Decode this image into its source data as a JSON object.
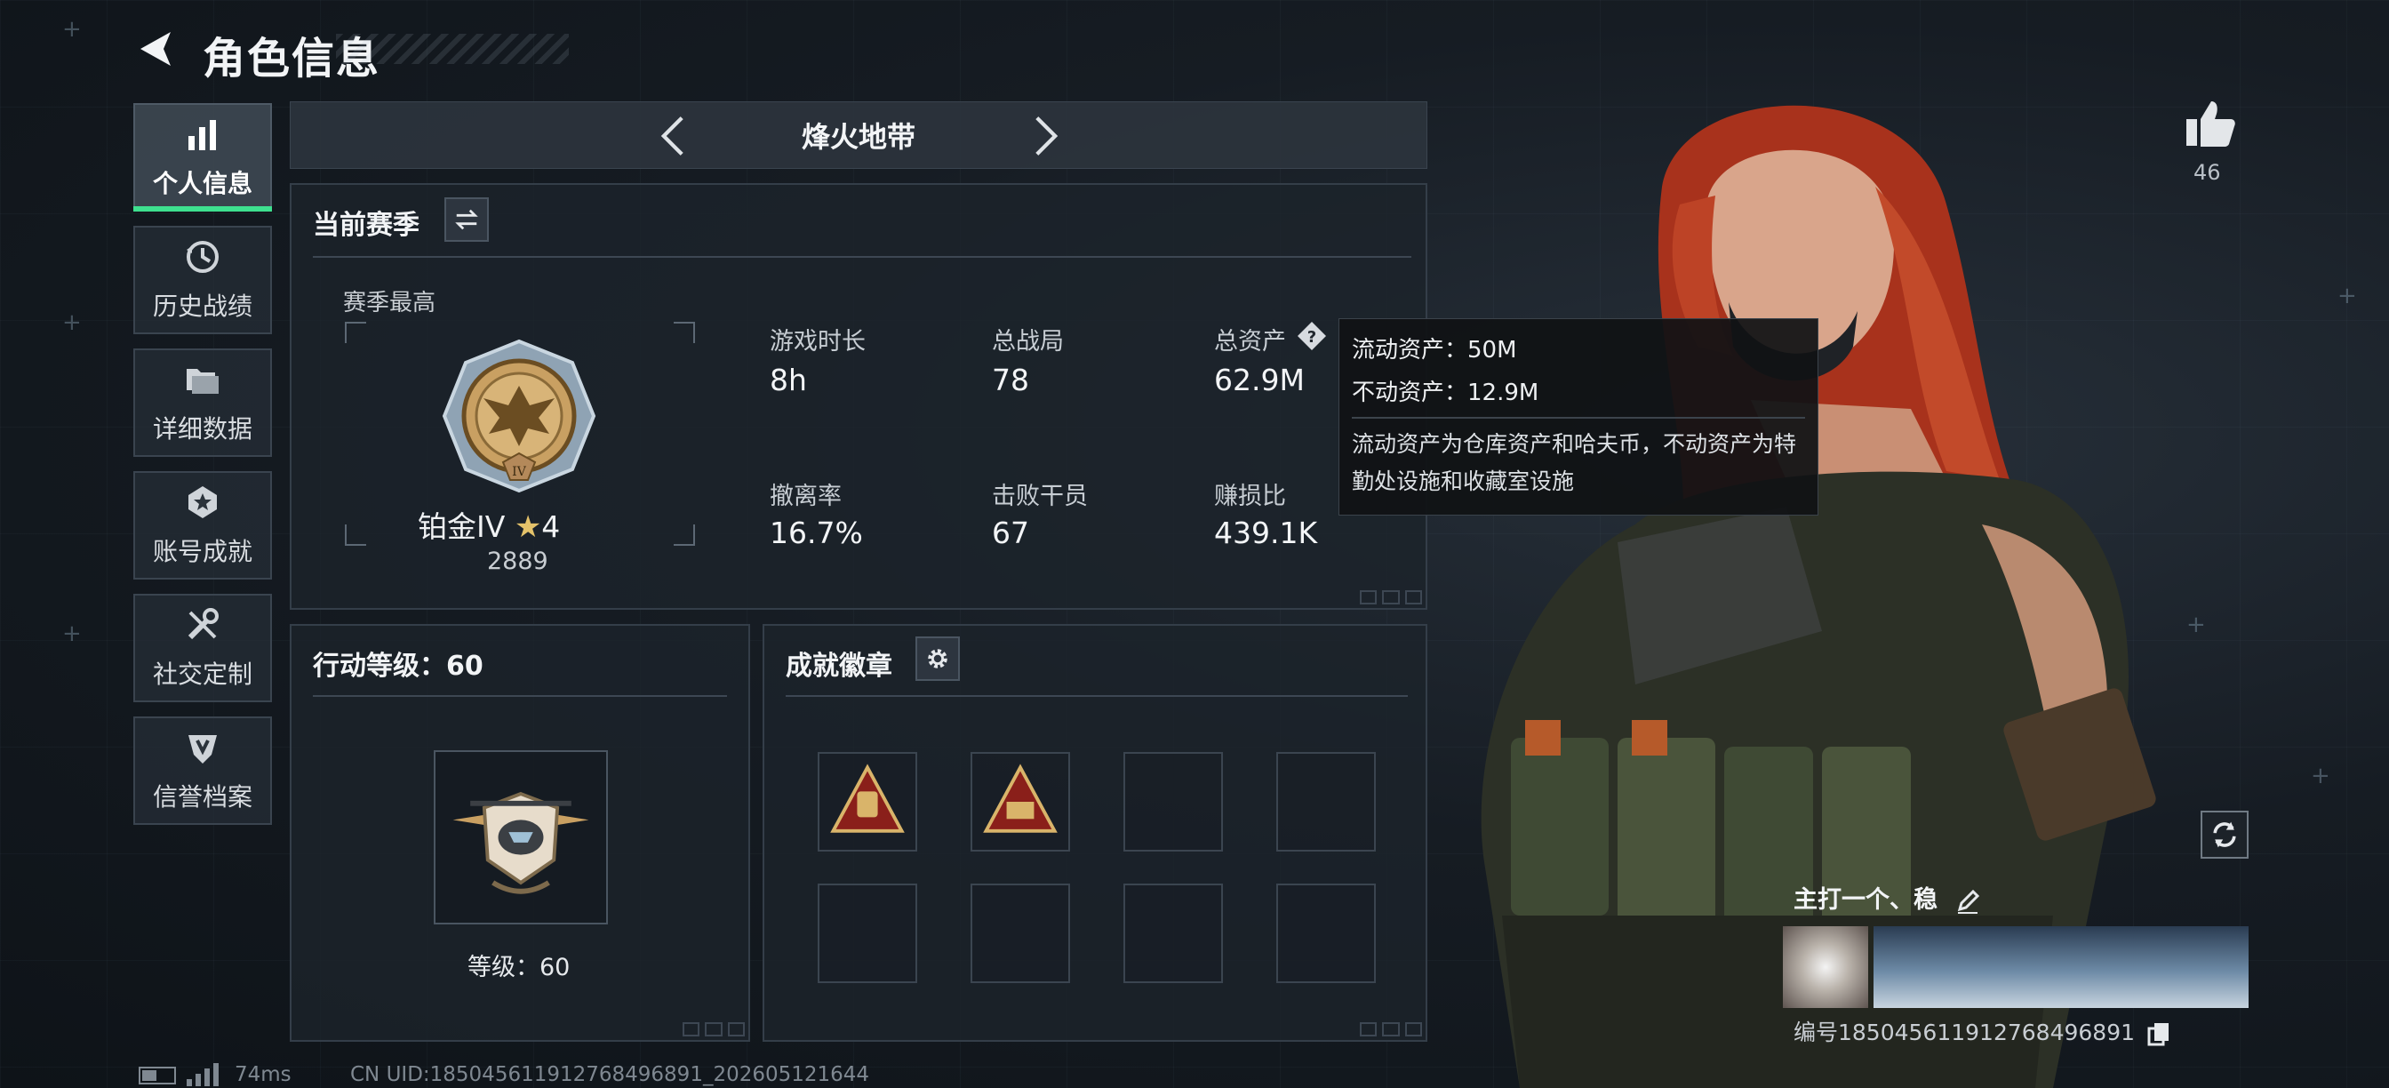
{
  "header": {
    "title": "角色信息"
  },
  "sidebar": {
    "items": [
      {
        "label": "个人信息",
        "icon": "bar-chart-icon",
        "active": true
      },
      {
        "label": "历史战绩",
        "icon": "history-clock-icon",
        "active": false
      },
      {
        "label": "详细数据",
        "icon": "folder-icon",
        "active": false
      },
      {
        "label": "账号成就",
        "icon": "medal-icon",
        "active": false
      },
      {
        "label": "社交定制",
        "icon": "tools-icon",
        "active": false
      },
      {
        "label": "信誉档案",
        "icon": "shield-icon",
        "active": false
      }
    ],
    "accent_color": "#3ee08f"
  },
  "map_selector": {
    "name": "烽火地带"
  },
  "season": {
    "title": "当前赛季",
    "best_label": "赛季最高",
    "rank": {
      "name": "铂金IV",
      "stars": "4",
      "score": "2889"
    },
    "stats": [
      {
        "label": "游戏时长",
        "value": "8h"
      },
      {
        "label": "总战局",
        "value": "78"
      },
      {
        "label": "总资产",
        "value": "62.9M"
      },
      {
        "label": "撤离率",
        "value": "16.7%"
      },
      {
        "label": "击败干员",
        "value": "67"
      },
      {
        "label": "赚损比",
        "value": "439.1K"
      }
    ]
  },
  "assets_tooltip": {
    "liquid": "流动资产：50M",
    "fixed": "不动资产：12.9M",
    "description": "流动资产为仓库资产和哈夫币，不动资产为特勤处设施和收藏室设施"
  },
  "action_level": {
    "title": "行动等级：60",
    "level_text": "等级：60"
  },
  "achievements": {
    "title": "成就徽章",
    "slots": [
      "badge-filled",
      "badge-filled",
      "empty",
      "empty",
      "empty",
      "empty",
      "empty",
      "empty"
    ]
  },
  "profile": {
    "likes": "46",
    "tagline": "主打一个、稳",
    "id_label": "编号1850456119127684968​91"
  },
  "footer": {
    "ping": "74ms",
    "uid": "CN UID:1850456119127684968​91_202605121644"
  }
}
